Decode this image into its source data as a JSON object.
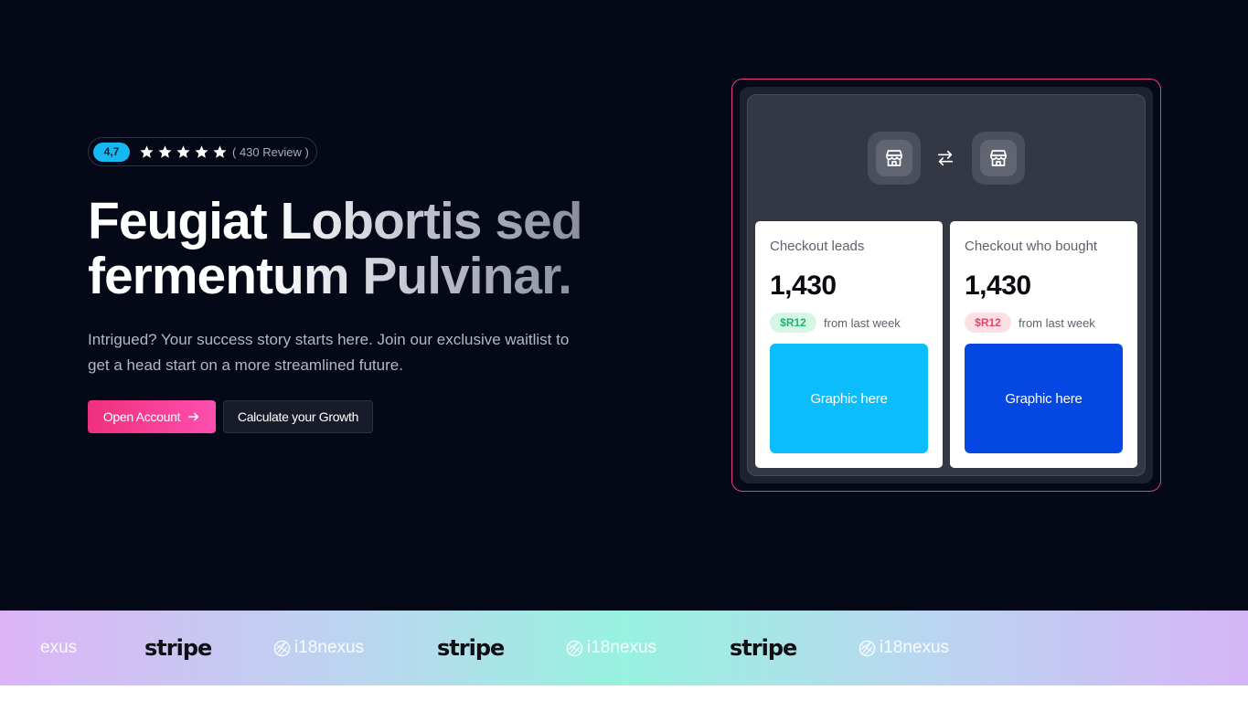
{
  "hero": {
    "rating": {
      "score": "4,7",
      "stars": 5,
      "review_text": "( 430 Review )",
      "badge_color": "#15b8f0"
    },
    "headline": {
      "line1": "Feugiat Lobortis sed",
      "line2": "fermentum Pulvinar."
    },
    "subtext": "Intrigued? Your success story starts here. Join our exclusive waitlist to get a head start on a more streamlined future.",
    "buttons": {
      "primary_label": "Open Account",
      "primary_icon": "arrow-right-icon",
      "secondary_label": "Calculate your Growth"
    }
  },
  "widget": {
    "icons": [
      "shop-icon",
      "swap-arrows-icon",
      "shop-icon"
    ],
    "cards": [
      {
        "title": "Checkout leads",
        "value": "1,430",
        "badge": "$R12",
        "badge_tone": "positive",
        "note": "from last week",
        "graphic_label": "Graphic here",
        "graphic_color": "#0cbdfb"
      },
      {
        "title": "Checkout who bought",
        "value": "1,430",
        "badge": "$R12",
        "badge_tone": "negative",
        "note": "from last week",
        "graphic_label": "Graphic here",
        "graphic_color": "#0447e2"
      }
    ]
  },
  "logos": {
    "items": [
      "exus",
      "stripe",
      "i18nexus",
      "stripe",
      "i18nexus",
      "stripe",
      "i18nexus"
    ]
  },
  "colors": {
    "background": "#050816",
    "accent_pink": "#f0307e",
    "accent_blue": "#15b8f0"
  }
}
